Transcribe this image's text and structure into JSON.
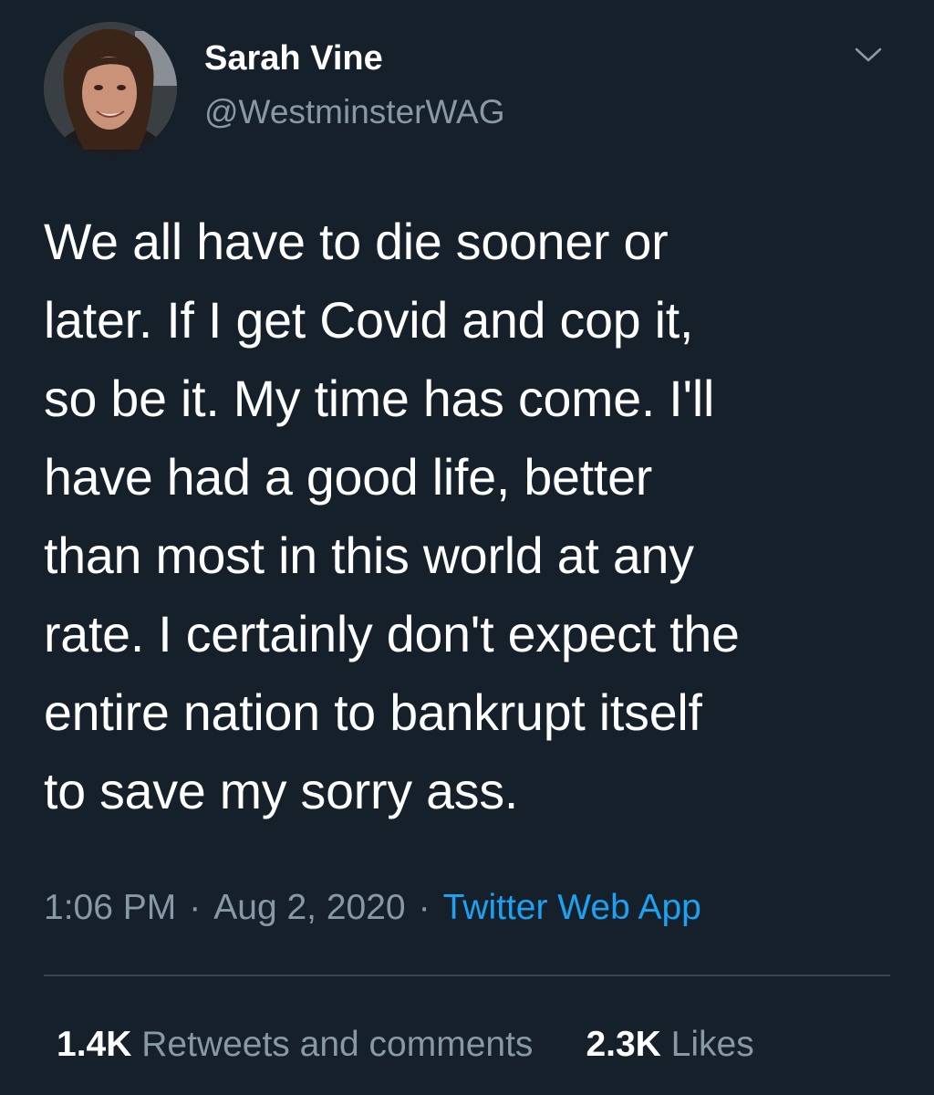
{
  "theme": {
    "background": "#15202b",
    "text_primary": "#ffffff",
    "text_secondary": "#8899a6",
    "link": "#1da1f2",
    "divider": "#38444d"
  },
  "author": {
    "name": "Sarah Vine",
    "handle": "@WestminsterWAG",
    "avatar_icon": "profile-photo"
  },
  "menu": {
    "icon": "chevron-down-icon"
  },
  "tweet": {
    "text": "We all have to die sooner or\nlater. If I get Covid and cop it,\nso be it. My time has come. I'll\nhave had a good life, better\nthan most in this world at any\nrate. I certainly don't expect the\nentire nation to bankrupt itself\nto save my sorry ass."
  },
  "meta": {
    "time": "1:06 PM",
    "separator": "·",
    "date": "Aug 2, 2020",
    "source": "Twitter Web App"
  },
  "stats": {
    "retweets_count": "1.4K",
    "retweets_label": "Retweets and comments",
    "likes_count": "2.3K",
    "likes_label": "Likes"
  }
}
